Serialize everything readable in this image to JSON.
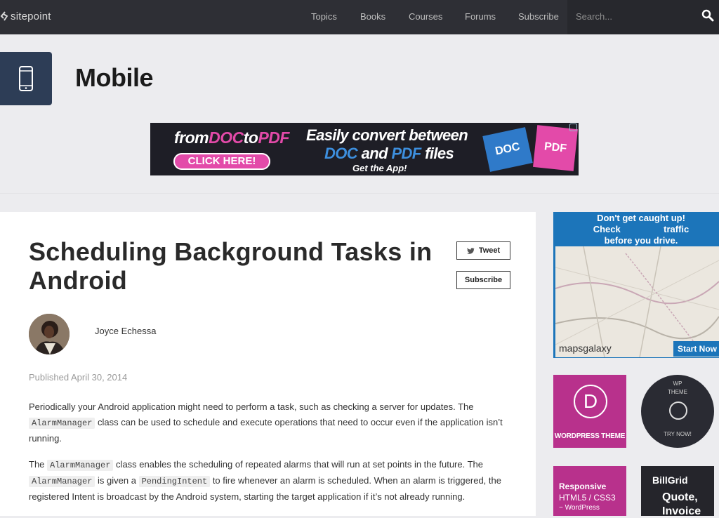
{
  "header": {
    "logo": "sitepoint",
    "nav": [
      "Topics",
      "Books",
      "Courses",
      "Forums",
      "Subscribe"
    ],
    "search_placeholder": "Search..."
  },
  "category": {
    "title": "Mobile"
  },
  "banner_ad": {
    "brand_a": "from",
    "brand_b": "DOC",
    "brand_c": "to",
    "brand_d": "PDF",
    "cta": "CLICK HERE!",
    "line1": "Easily convert between",
    "line2_a": "DOC",
    "line2_b": " and ",
    "line2_c": "PDF",
    "line2_d": " files",
    "line3": "Get the App!",
    "doc_label": "DOC",
    "pdf_label": "PDF"
  },
  "article": {
    "title": "Scheduling Background Tasks in Android",
    "tweet_label": "Tweet",
    "subscribe_label": "Subscribe",
    "author": "Joyce Echessa",
    "published": "Published April 30, 2014",
    "p1": {
      "a": "Periodically your Android application might need to perform a task, such as checking a server for updates. The",
      "code1": "AlarmManager",
      "b": " class can be used to schedule and execute operations that need to occur even if the application isn’t running."
    },
    "p2": {
      "a": "The ",
      "code1": "AlarmManager",
      "b": " class enables the scheduling of repeated alarms that will run at set points in the future. The",
      "code2": "AlarmManager",
      "c": " is given a ",
      "code3": "PendingIntent",
      "d": " to fire whenever an alarm is scheduled. When an alarm is triggered, the registered Intent is broadcast by the Android system, starting the target application if it’s not already running."
    }
  },
  "sidebar": {
    "map_ad": {
      "line1": "Don't get caught up!",
      "line2": "Check                 traffic",
      "line3": "before you drive.",
      "brand": "mapsgalaxy",
      "cta": "Start Now"
    },
    "wp_theme": {
      "label": "WORDPRESS THEME"
    },
    "wp_circle": {
      "line1": "WP",
      "line2": "THEME",
      "line3": "TRY NOW!"
    },
    "responsive": {
      "line1": "Responsive",
      "line2": "HTML5 / CSS3",
      "line3": "~ WordPress"
    },
    "billgrid": {
      "brand": "BillGrid",
      "line1": "Quote,",
      "line2": "Invoice"
    }
  }
}
